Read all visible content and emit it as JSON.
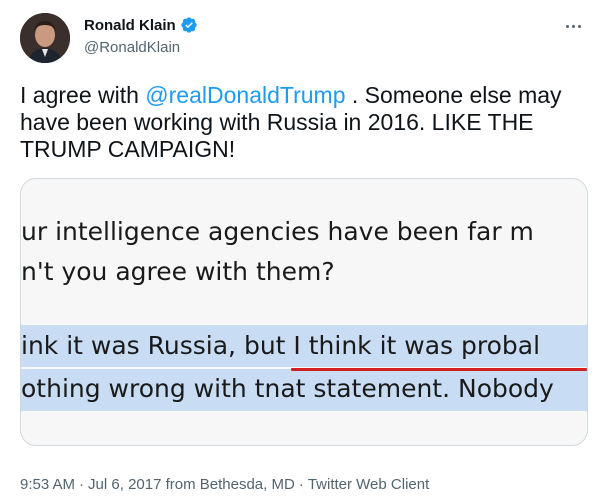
{
  "author": {
    "display_name": "Ronald Klain",
    "handle": "@RonaldKlain",
    "verified": true
  },
  "tweet": {
    "text_before": "I agree with ",
    "mention": "@realDonaldTrump",
    "text_after": " .  Someone else may have been working with Russia in 2016.  LIKE THE TRUMP CAMPAIGN!"
  },
  "media": {
    "lines": [
      "ur intelligence agencies have been far m",
      "n't you agree with them?",
      "ink it was Russia, but I think it was probal",
      "othing wrong with tnat statement. Nobody"
    ]
  },
  "meta": {
    "time": "9:53 AM",
    "date": "Jul 6, 2017 from Bethesda, MD",
    "separator": "·",
    "client": "Twitter Web Client"
  },
  "colors": {
    "link": "#1d9bf0",
    "verified": "#1d9bf0",
    "highlight": "#c8dcf4",
    "underline": "#d32020",
    "secondary_text": "#536471"
  },
  "icons": {
    "more": "more-horizontal-icon",
    "verified": "verified-badge-icon"
  }
}
